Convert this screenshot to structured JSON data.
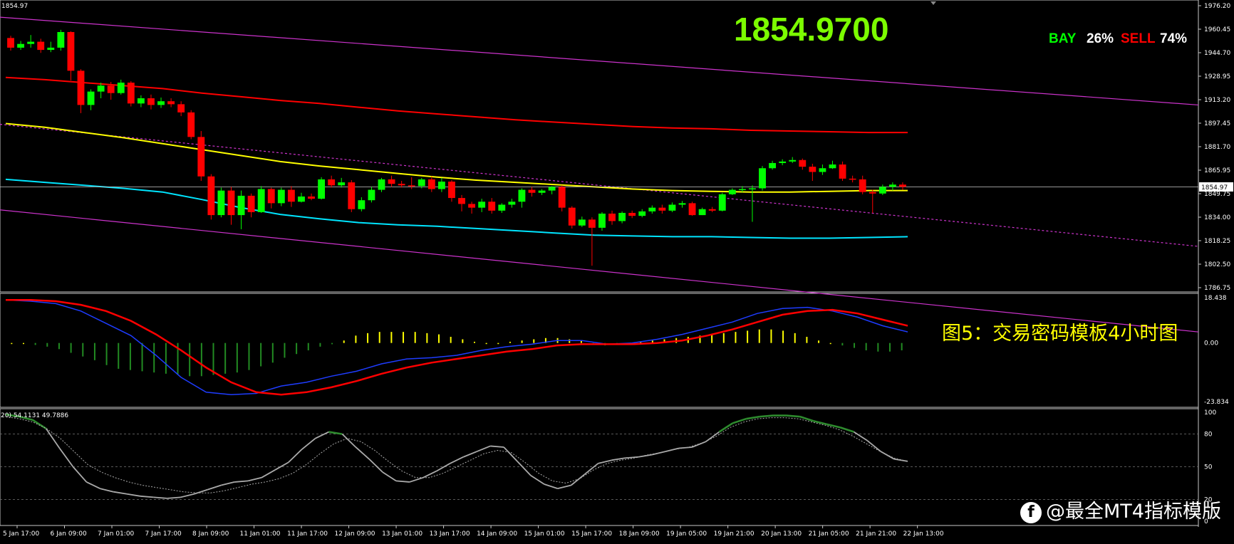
{
  "price_display": {
    "last_price": "1854.9700",
    "header_price": "1854.97",
    "price_tag": "1854.97"
  },
  "sentiment": {
    "buy_label": "BAY",
    "buy_percent": "26%",
    "sell_label": "SELL",
    "sell_percent": "74%"
  },
  "caption": "图5：交易密码模板4小时图",
  "watermark": "@最全MT4指标模版",
  "oscillator_header": "20) 54.1131 49.7886",
  "colors": {
    "background": "#000000",
    "bull_candle": "#00ff00",
    "bear_candle": "#ff0000",
    "ma_red": "#ff0000",
    "ma_yellow": "#ffff00",
    "ma_cyan": "#00e5ff",
    "channel": "#cc33cc",
    "grid": "#c8c8c8"
  },
  "chart_data": [
    {
      "type": "candlestick",
      "panel": "price",
      "ylim": [
        1786.75,
        1976.2
      ],
      "y_ticks": [
        "1976.20",
        "1960.45",
        "1944.70",
        "1928.95",
        "1913.20",
        "1897.45",
        "1881.70",
        "1865.95",
        "1849.75",
        "1834.00",
        "1818.25",
        "1802.50",
        "1786.75"
      ],
      "x_ticks": [
        "5 Jan 17:00",
        "6 Jan 09:00",
        "7 Jan 01:00",
        "7 Jan 17:00",
        "8 Jan 09:00",
        "11 Jan 01:00",
        "11 Jan 17:00",
        "12 Jan 09:00",
        "13 Jan 01:00",
        "13 Jan 17:00",
        "14 Jan 09:00",
        "15 Jan 01:00",
        "15 Jan 17:00",
        "18 Jan 09:00",
        "19 Jan 05:00",
        "19 Jan 21:00",
        "20 Jan 13:00",
        "21 Jan 05:00",
        "21 Jan 21:00",
        "22 Jan 13:00"
      ],
      "candles": [
        [
          1954.5,
          1948.0,
          1956.0,
          1946.0
        ],
        [
          1948.0,
          1950.5,
          1952.5,
          1946.5
        ],
        [
          1950.5,
          1952.0,
          1956.5,
          1948.0
        ],
        [
          1952.0,
          1946.5,
          1954.0,
          1944.5
        ],
        [
          1946.5,
          1948.0,
          1952.0,
          1945.0
        ],
        [
          1948.0,
          1958.5,
          1960.0,
          1946.0
        ],
        [
          1958.5,
          1932.5,
          1959.0,
          1926.0
        ],
        [
          1932.5,
          1909.5,
          1933.5,
          1904.0
        ],
        [
          1909.5,
          1918.5,
          1920.0,
          1906.0
        ],
        [
          1918.5,
          1922.5,
          1924.5,
          1914.0
        ],
        [
          1922.5,
          1917.5,
          1925.0,
          1913.0
        ],
        [
          1917.5,
          1924.5,
          1926.5,
          1916.5
        ],
        [
          1924.5,
          1910.5,
          1925.5,
          1908.5
        ],
        [
          1910.5,
          1914.0,
          1916.0,
          1908.0
        ],
        [
          1914.0,
          1909.5,
          1916.5,
          1906.5
        ],
        [
          1909.5,
          1912.0,
          1914.5,
          1907.5
        ],
        [
          1912.0,
          1910.0,
          1914.0,
          1908.0
        ],
        [
          1910.0,
          1904.5,
          1912.0,
          1902.0
        ],
        [
          1904.5,
          1888.0,
          1906.0,
          1886.5
        ],
        [
          1888.0,
          1861.5,
          1892.0,
          1858.5
        ],
        [
          1861.5,
          1835.5,
          1863.0,
          1832.5
        ],
        [
          1835.5,
          1852.0,
          1854.0,
          1834.0
        ],
        [
          1852.0,
          1835.5,
          1854.5,
          1829.0
        ],
        [
          1835.5,
          1848.5,
          1852.0,
          1826.0
        ],
        [
          1848.5,
          1837.5,
          1850.0,
          1834.0
        ],
        [
          1837.5,
          1853.0,
          1855.0,
          1837.0
        ],
        [
          1853.0,
          1843.5,
          1854.0,
          1840.0
        ],
        [
          1843.5,
          1852.5,
          1854.0,
          1841.5
        ],
        [
          1852.5,
          1844.5,
          1855.0,
          1841.0
        ],
        [
          1844.5,
          1848.0,
          1850.5,
          1844.0
        ],
        [
          1848.0,
          1846.5,
          1850.0,
          1845.5
        ],
        [
          1846.5,
          1859.5,
          1861.0,
          1846.0
        ],
        [
          1859.5,
          1855.5,
          1862.0,
          1854.0
        ],
        [
          1855.5,
          1857.5,
          1860.5,
          1854.0
        ],
        [
          1857.5,
          1839.5,
          1859.0,
          1837.5
        ],
        [
          1839.5,
          1845.5,
          1847.5,
          1838.0
        ],
        [
          1845.5,
          1852.5,
          1854.5,
          1844.0
        ],
        [
          1852.5,
          1859.5,
          1860.5,
          1851.0
        ],
        [
          1859.5,
          1856.5,
          1862.0,
          1854.5
        ],
        [
          1856.5,
          1855.5,
          1858.5,
          1854.0
        ],
        [
          1855.5,
          1855.0,
          1861.0,
          1853.0
        ],
        [
          1855.0,
          1859.5,
          1860.5,
          1853.5
        ],
        [
          1859.5,
          1853.0,
          1861.5,
          1851.0
        ],
        [
          1853.0,
          1858.0,
          1860.5,
          1851.0
        ],
        [
          1858.0,
          1847.0,
          1859.0,
          1844.5
        ],
        [
          1847.0,
          1843.0,
          1849.0,
          1838.0
        ],
        [
          1843.0,
          1840.5,
          1844.5,
          1836.5
        ],
        [
          1840.5,
          1844.5,
          1846.5,
          1837.5
        ],
        [
          1844.5,
          1838.5,
          1847.0,
          1836.5
        ],
        [
          1838.5,
          1842.5,
          1843.5,
          1837.0
        ],
        [
          1842.5,
          1844.5,
          1846.5,
          1840.5
        ],
        [
          1844.5,
          1852.5,
          1853.5,
          1840.5
        ],
        [
          1852.5,
          1850.5,
          1854.5,
          1848.0
        ],
        [
          1850.5,
          1852.0,
          1853.0,
          1849.0
        ],
        [
          1852.0,
          1854.5,
          1855.0,
          1849.5
        ],
        [
          1854.5,
          1840.5,
          1855.5,
          1838.0
        ],
        [
          1840.5,
          1828.5,
          1841.5,
          1826.5
        ],
        [
          1828.5,
          1832.5,
          1834.5,
          1827.5
        ],
        [
          1832.5,
          1827.0,
          1834.0,
          1801.5
        ],
        [
          1827.0,
          1836.5,
          1837.5,
          1825.0
        ],
        [
          1836.5,
          1831.5,
          1838.5,
          1829.0
        ],
        [
          1831.5,
          1837.0,
          1838.0,
          1830.0
        ],
        [
          1837.0,
          1835.0,
          1838.5,
          1833.5
        ],
        [
          1835.0,
          1838.0,
          1839.5,
          1834.0
        ],
        [
          1838.0,
          1840.5,
          1842.0,
          1836.5
        ],
        [
          1840.5,
          1838.5,
          1842.5,
          1836.5
        ],
        [
          1838.5,
          1842.5,
          1844.0,
          1837.5
        ],
        [
          1842.5,
          1843.5,
          1845.0,
          1840.5
        ],
        [
          1843.5,
          1835.5,
          1844.5,
          1835.0
        ],
        [
          1835.5,
          1839.5,
          1840.5,
          1835.5
        ],
        [
          1839.5,
          1838.5,
          1841.0,
          1837.5
        ],
        [
          1838.5,
          1849.5,
          1850.5,
          1838.0
        ],
        [
          1849.5,
          1852.5,
          1853.5,
          1849.0
        ],
        [
          1852.5,
          1853.0,
          1855.0,
          1851.0
        ],
        [
          1853.0,
          1853.5,
          1855.5,
          1831.0
        ],
        [
          1853.5,
          1867.0,
          1868.5,
          1852.0
        ],
        [
          1867.0,
          1870.5,
          1872.0,
          1866.0
        ],
        [
          1870.5,
          1871.5,
          1873.0,
          1869.0
        ],
        [
          1871.5,
          1872.5,
          1874.5,
          1870.5
        ],
        [
          1872.5,
          1868.0,
          1873.5,
          1866.0
        ],
        [
          1868.0,
          1864.5,
          1870.0,
          1858.5
        ],
        [
          1864.5,
          1867.0,
          1869.5,
          1862.5
        ],
        [
          1867.0,
          1869.5,
          1872.0,
          1866.5
        ],
        [
          1869.5,
          1860.0,
          1871.5,
          1858.5
        ],
        [
          1860.0,
          1859.5,
          1862.0,
          1857.5
        ],
        [
          1859.5,
          1851.0,
          1862.0,
          1849.5
        ],
        [
          1851.0,
          1850.0,
          1852.5,
          1837.0
        ],
        [
          1850.0,
          1854.5,
          1856.0,
          1849.0
        ],
        [
          1854.5,
          1856.0,
          1857.5,
          1852.0
        ],
        [
          1856.0,
          1854.5,
          1857.5,
          1852.5
        ]
      ],
      "moving_averages": [
        {
          "color": "#ff0000",
          "values": [
            1928.0,
            1926.5,
            1924.5,
            1922.5,
            1920.5,
            1917.5,
            1915.0,
            1912.5,
            1910.5,
            1908.0,
            1905.5,
            1903.5,
            1901.5,
            1899.5,
            1898.0,
            1896.5,
            1895.0,
            1894.0,
            1893.5,
            1892.5,
            1892.0,
            1891.5,
            1891.0,
            1891.0
          ]
        },
        {
          "color": "#ffff00",
          "values": [
            1897.0,
            1894.5,
            1891.0,
            1887.5,
            1883.5,
            1879.5,
            1875.5,
            1871.5,
            1868.5,
            1866.0,
            1863.5,
            1861.0,
            1859.0,
            1857.5,
            1856.0,
            1854.5,
            1853.0,
            1852.0,
            1851.5,
            1851.0,
            1851.0,
            1851.5,
            1852.0,
            1852.0
          ]
        },
        {
          "color": "#00e5ff",
          "values": [
            1859.5,
            1857.5,
            1855.5,
            1853.5,
            1851.0,
            1846.0,
            1840.5,
            1836.0,
            1833.0,
            1830.5,
            1829.0,
            1828.0,
            1826.5,
            1825.0,
            1823.5,
            1822.0,
            1821.5,
            1821.0,
            1821.0,
            1820.5,
            1820.0,
            1820.0,
            1820.5,
            1821.0
          ]
        }
      ],
      "channel_lines": [
        {
          "from": [
            0,
            1968.5
          ],
          "to": [
            1,
            1909.5
          ]
        },
        {
          "from": [
            0,
            1896.5
          ],
          "to": [
            1,
            1814.5
          ]
        },
        {
          "from": [
            0,
            1839.0
          ],
          "to": [
            1,
            1757.0
          ]
        }
      ]
    },
    {
      "type": "histogram+line",
      "panel": "macd",
      "ylim": [
        -23.834,
        18.438
      ],
      "y_ticks": [
        "18.438",
        "0.00",
        "-23.834"
      ],
      "histogram": [
        0.0,
        0.0,
        -0.8,
        -1.5,
        -2.5,
        -4.0,
        -5.5,
        -7.0,
        -9.0,
        -10.5,
        -11.0,
        -11.5,
        -12.0,
        -12.5,
        -13.0,
        -13.5,
        -13.5,
        -13.0,
        -12.5,
        -12.0,
        -11.0,
        -9.5,
        -8.0,
        -6.0,
        -4.5,
        -3.0,
        -1.5,
        -0.5,
        1.0,
        3.0,
        4.0,
        4.5,
        4.5,
        4.5,
        4.5,
        4.0,
        3.5,
        2.5,
        1.5,
        0.5,
        0.0,
        0.0,
        0.5,
        1.0,
        1.5,
        2.0,
        2.0,
        1.5,
        1.0,
        -0.5,
        -1.0,
        -0.5,
        0.0,
        0.5,
        1.0,
        1.5,
        2.0,
        2.5,
        3.0,
        3.5,
        4.0,
        4.5,
        5.0,
        5.5,
        5.5,
        5.0,
        4.0,
        2.5,
        1.0,
        0.0,
        -1.0,
        -2.0,
        -3.0,
        -3.5,
        -3.5,
        -3.0
      ],
      "lines": [
        {
          "color": "#1e3cff",
          "values": [
            17.5,
            17.0,
            16.0,
            13.0,
            8.0,
            3.0,
            -5.0,
            -14.0,
            -20.0,
            -21.0,
            -20.5,
            -17.5,
            -16.0,
            -13.5,
            -11.5,
            -8.5,
            -6.5,
            -6.0,
            -5.0,
            -3.0,
            -1.5,
            -0.5,
            1.0,
            1.0,
            -0.5,
            0.0,
            1.5,
            3.5,
            6.0,
            8.5,
            12.0,
            14.0,
            14.5,
            13.0,
            10.5,
            7.0,
            4.5
          ]
        },
        {
          "color": "#ff0000",
          "values": [
            17.5,
            17.5,
            17.0,
            15.5,
            13.0,
            9.0,
            3.5,
            -3.0,
            -10.0,
            -16.0,
            -20.0,
            -21.0,
            -20.0,
            -18.0,
            -15.5,
            -12.5,
            -10.0,
            -8.0,
            -6.5,
            -5.0,
            -3.5,
            -2.5,
            -1.0,
            -0.5,
            -0.5,
            -0.5,
            0.0,
            1.0,
            3.0,
            5.5,
            8.5,
            11.5,
            13.0,
            13.5,
            12.0,
            9.5,
            7.0
          ]
        }
      ]
    },
    {
      "type": "line",
      "panel": "oscillator",
      "ylim": [
        0,
        100
      ],
      "y_ticks": [
        "100",
        "80",
        "50",
        "20",
        "0"
      ],
      "series": [
        {
          "color": "#aaaaaa",
          "values": [
            98.0,
            96.0,
            93.0,
            85.0,
            67.0,
            50.0,
            36.0,
            30.0,
            27.0,
            25.0,
            23.0,
            22.0,
            21.0,
            22.0,
            25.0,
            29.0,
            33.0,
            36.0,
            37.0,
            40.0,
            47.0,
            54.0,
            66.0,
            76.0,
            82.0,
            80.0,
            68.0,
            57.0,
            45.0,
            37.0,
            36.0,
            40.0,
            46.0,
            53.0,
            59.0,
            64.0,
            69.0,
            68.0,
            55.0,
            42.0,
            34.0,
            30.0,
            33.0,
            43.0,
            53.0,
            56.0,
            58.0,
            59.0,
            61.0,
            64.0,
            67.0,
            68.0,
            73.0,
            82.0,
            90.0,
            94.0,
            96.0,
            97.0,
            97.0,
            96.0,
            92.0,
            89.0,
            86.0,
            82.0,
            74.0,
            64.0,
            57.0,
            55.0
          ]
        },
        {
          "color": "#aaaaaa",
          "dashed": true,
          "values": [
            96.0,
            94.0,
            91.0,
            85.0,
            76.0,
            64.0,
            52.0,
            45.0,
            40.0,
            36.0,
            33.0,
            31.0,
            29.0,
            27.0,
            26.0,
            26.0,
            28.0,
            31.0,
            34.0,
            36.0,
            39.0,
            44.0,
            52.0,
            62.0,
            71.0,
            76.0,
            73.0,
            65.0,
            55.0,
            46.0,
            40.0,
            40.0,
            44.0,
            50.0,
            56.0,
            62.0,
            65.0,
            63.0,
            54.0,
            44.0,
            37.0,
            35.0,
            39.0,
            47.0,
            53.0,
            56.0,
            58.0,
            61.0,
            63.0,
            66.0,
            68.0,
            72.0,
            78.0,
            86.0,
            91.0,
            94.0,
            95.0,
            95.0,
            94.0,
            91.0,
            88.0,
            84.0,
            78.0,
            71.0,
            64.0,
            58.0,
            55.0
          ]
        }
      ]
    }
  ]
}
